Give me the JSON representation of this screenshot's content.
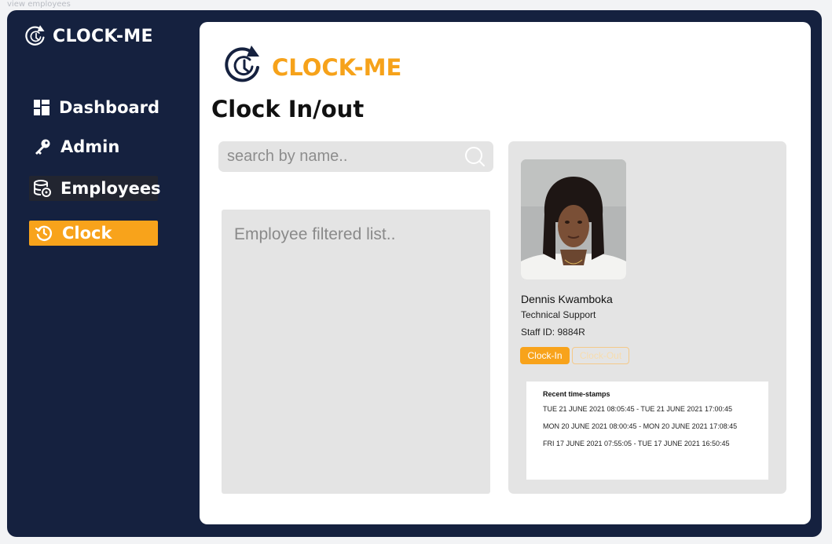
{
  "frame_label": "view  employees",
  "brand": {
    "name": "CLOCK-ME",
    "accent": "#f8a31b",
    "navy": "#15213f"
  },
  "sidebar": {
    "items": [
      {
        "label": "Dashboard",
        "icon": "grid-icon"
      },
      {
        "label": "Admin",
        "icon": "key-icon"
      },
      {
        "label": "Employees",
        "icon": "database-icon"
      },
      {
        "label": "Clock",
        "icon": "history-icon",
        "active": true
      }
    ]
  },
  "main": {
    "page_title": "Clock In/out",
    "search": {
      "placeholder": "search by name.."
    },
    "list_placeholder": "Employee filtered list..",
    "employee": {
      "name": "Dennis Kwamboka",
      "role": "Technical Support",
      "staff_id": "Staff ID: 9884R"
    },
    "buttons": {
      "clock_in": "Clock-In",
      "clock_out": "Clock-Out"
    },
    "timestamps": {
      "title": "Recent time-stamps",
      "entries": [
        "TUE 21 JUNE 2021 08:05:45 - TUE 21 JUNE 2021 17:00:45",
        "MON 20 JUNE 2021 08:00:45 - MON 20 JUNE 2021 17:08:45",
        "FRI 17 JUNE 2021 07:55:05 - TUE 17 JUNE 2021 16:50:45"
      ]
    }
  }
}
